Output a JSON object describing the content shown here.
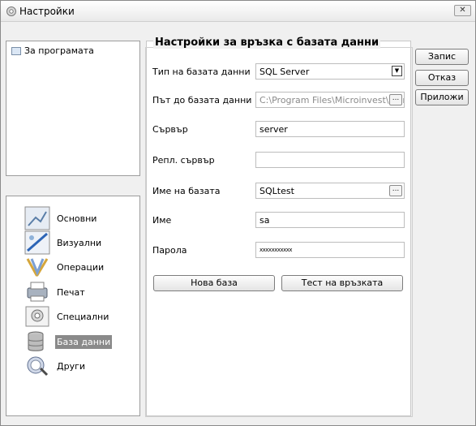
{
  "window": {
    "title": "Настройки",
    "close_label": "✕"
  },
  "left_tree": {
    "items": [
      {
        "label": "За програмата",
        "icon": "folder-icon"
      }
    ]
  },
  "nav": {
    "items": [
      {
        "label": "Основни",
        "icon": "basic-settings-icon"
      },
      {
        "label": "Визуални",
        "icon": "visual-settings-icon"
      },
      {
        "label": "Операции",
        "icon": "operations-icon"
      },
      {
        "label": "Печат",
        "icon": "printer-icon"
      },
      {
        "label": "Специални",
        "icon": "special-settings-icon"
      },
      {
        "label": "База данни",
        "icon": "database-icon",
        "selected": true
      },
      {
        "label": "Други",
        "icon": "other-settings-icon"
      }
    ]
  },
  "panel": {
    "title": "Настройки за връзка с базата данни",
    "fields": {
      "db_type": {
        "label": "Тип на базата данни",
        "value": "SQL Server"
      },
      "db_path": {
        "label": "Път до базата данни",
        "value": "C:\\Program Files\\Microinvest\\Ware"
      },
      "server": {
        "label": "Сървър",
        "value": "server"
      },
      "repl_server": {
        "label": "Репл. сървър",
        "value": ""
      },
      "db_name": {
        "label": "Име на базата",
        "value": "SQLtest"
      },
      "username": {
        "label": "Име",
        "value": "sa"
      },
      "password": {
        "label": "Парола",
        "value": "xxxxxxxxxxx"
      }
    },
    "buttons": {
      "new_db": "Нова база",
      "test_connection": "Тест на връзката"
    }
  },
  "actions": {
    "save": "Запис",
    "cancel": "Отказ",
    "apply": "Приложи"
  },
  "colors": {
    "selected_nav_bg": "#8a8a8a",
    "window_bg": "#f0f0f0"
  }
}
